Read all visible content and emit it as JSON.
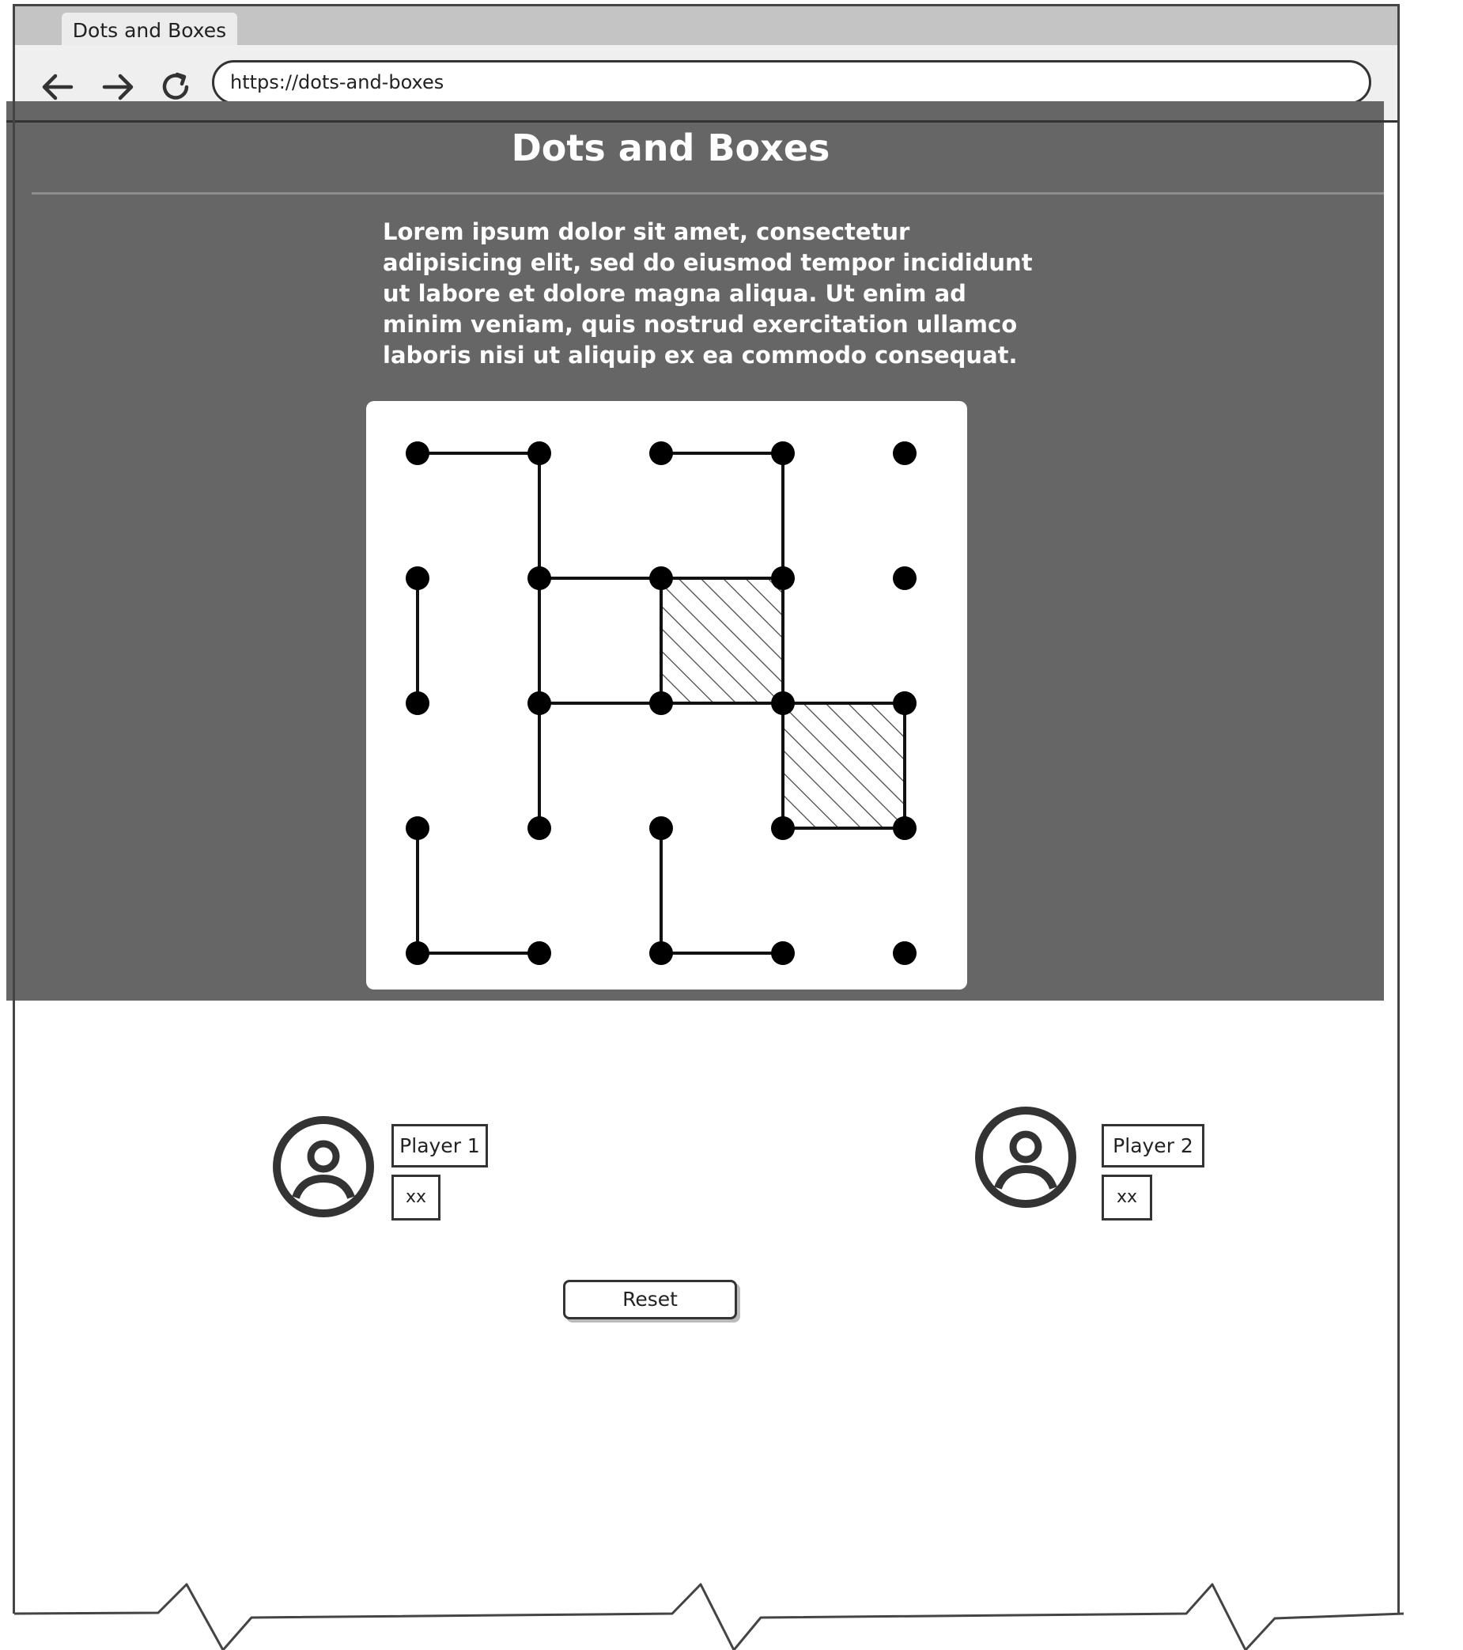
{
  "browser": {
    "tab_title": "Dots and Boxes",
    "url": "https://dots-and-boxes"
  },
  "page": {
    "title": "Dots and Boxes",
    "description": "Lorem ipsum dolor sit amet, consectetur adipisicing elit, sed do eiusmod tempor incididunt ut labore et dolore magna aliqua. Ut enim ad minim veniam, quis nostrud exercitation ullamco laboris nisi ut aliquip ex ea commodo consequat."
  },
  "board": {
    "rows": 5,
    "cols": 5,
    "edges": [
      [
        [
          0,
          0
        ],
        [
          0,
          1
        ]
      ],
      [
        [
          0,
          2
        ],
        [
          0,
          3
        ]
      ],
      [
        [
          0,
          1
        ],
        [
          1,
          1
        ]
      ],
      [
        [
          0,
          3
        ],
        [
          1,
          3
        ]
      ],
      [
        [
          1,
          1
        ],
        [
          1,
          2
        ]
      ],
      [
        [
          1,
          2
        ],
        [
          1,
          3
        ]
      ],
      [
        [
          1,
          0
        ],
        [
          2,
          0
        ]
      ],
      [
        [
          1,
          1
        ],
        [
          2,
          1
        ]
      ],
      [
        [
          1,
          2
        ],
        [
          2,
          2
        ]
      ],
      [
        [
          1,
          3
        ],
        [
          2,
          3
        ]
      ],
      [
        [
          2,
          1
        ],
        [
          2,
          2
        ]
      ],
      [
        [
          2,
          2
        ],
        [
          2,
          3
        ]
      ],
      [
        [
          2,
          3
        ],
        [
          2,
          4
        ]
      ],
      [
        [
          2,
          1
        ],
        [
          3,
          1
        ]
      ],
      [
        [
          2,
          3
        ],
        [
          3,
          3
        ]
      ],
      [
        [
          2,
          4
        ],
        [
          3,
          4
        ]
      ],
      [
        [
          3,
          3
        ],
        [
          3,
          4
        ]
      ],
      [
        [
          3,
          0
        ],
        [
          4,
          0
        ]
      ],
      [
        [
          3,
          2
        ],
        [
          4,
          2
        ]
      ],
      [
        [
          4,
          0
        ],
        [
          4,
          1
        ]
      ],
      [
        [
          4,
          2
        ],
        [
          4,
          3
        ]
      ]
    ],
    "claimed_boxes": [
      [
        1,
        2
      ],
      [
        2,
        3
      ]
    ]
  },
  "players": [
    {
      "name": "Player 1",
      "score": "xx"
    },
    {
      "name": "Player 2",
      "score": "xx"
    }
  ],
  "controls": {
    "reset_label": "Reset"
  }
}
